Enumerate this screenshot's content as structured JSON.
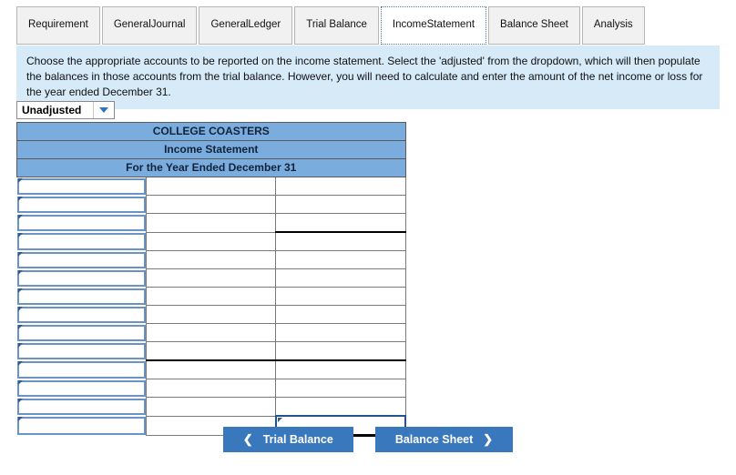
{
  "tabs": [
    {
      "label": "Requirement",
      "active": false
    },
    {
      "label": "General Journal",
      "active": false
    },
    {
      "label": "General Ledger",
      "active": false
    },
    {
      "label": "Trial Balance",
      "active": false
    },
    {
      "label": "Income Statement",
      "active": true
    },
    {
      "label": "Balance Sheet",
      "active": false
    },
    {
      "label": "Analysis",
      "active": false
    }
  ],
  "instruction": "Choose the appropriate accounts to be reported on the income statement. Select the 'adjusted' from the dropdown, which will then populate the balances in those accounts from the trial balance. However, you will need to calculate and enter the amount of the net income or loss for the year ended December 31.",
  "dropdown": {
    "value": "Unadjusted",
    "arrow_icon": "chevron-down-icon"
  },
  "statement": {
    "company": "COLLEGE COASTERS",
    "title": "Income Statement",
    "period": "For the Year Ended December 31",
    "row_count": 14,
    "rows": [
      {
        "account": "",
        "amount1": "",
        "amount2": ""
      },
      {
        "account": "",
        "amount1": "",
        "amount2": ""
      },
      {
        "account": "",
        "amount1": "",
        "amount2": "",
        "rule_amount2": true
      },
      {
        "account": "",
        "amount1": "",
        "amount2": ""
      },
      {
        "account": "",
        "amount1": "",
        "amount2": ""
      },
      {
        "account": "",
        "amount1": "",
        "amount2": ""
      },
      {
        "account": "",
        "amount1": "",
        "amount2": ""
      },
      {
        "account": "",
        "amount1": "",
        "amount2": ""
      },
      {
        "account": "",
        "amount1": "",
        "amount2": ""
      },
      {
        "account": "",
        "amount1": "",
        "amount2": "",
        "rule_amount1": true,
        "rule_amount2": true
      },
      {
        "account": "",
        "amount1": "",
        "amount2": ""
      },
      {
        "account": "",
        "amount1": "",
        "amount2": ""
      },
      {
        "account": "",
        "amount1": "",
        "amount2": ""
      },
      {
        "account": "",
        "amount1": "",
        "amount2": "",
        "amount2_selected": true
      }
    ]
  },
  "buttons": {
    "prev": {
      "label": "Trial Balance",
      "icon": "chevron-left-icon"
    },
    "next": {
      "label": "Balance Sheet",
      "icon": "chevron-right-icon"
    }
  },
  "colors": {
    "header_blue": "#7bacde",
    "banner_blue": "#d7eaf8",
    "button_blue": "#3a78bd",
    "input_border_blue": "#6a94c4"
  }
}
